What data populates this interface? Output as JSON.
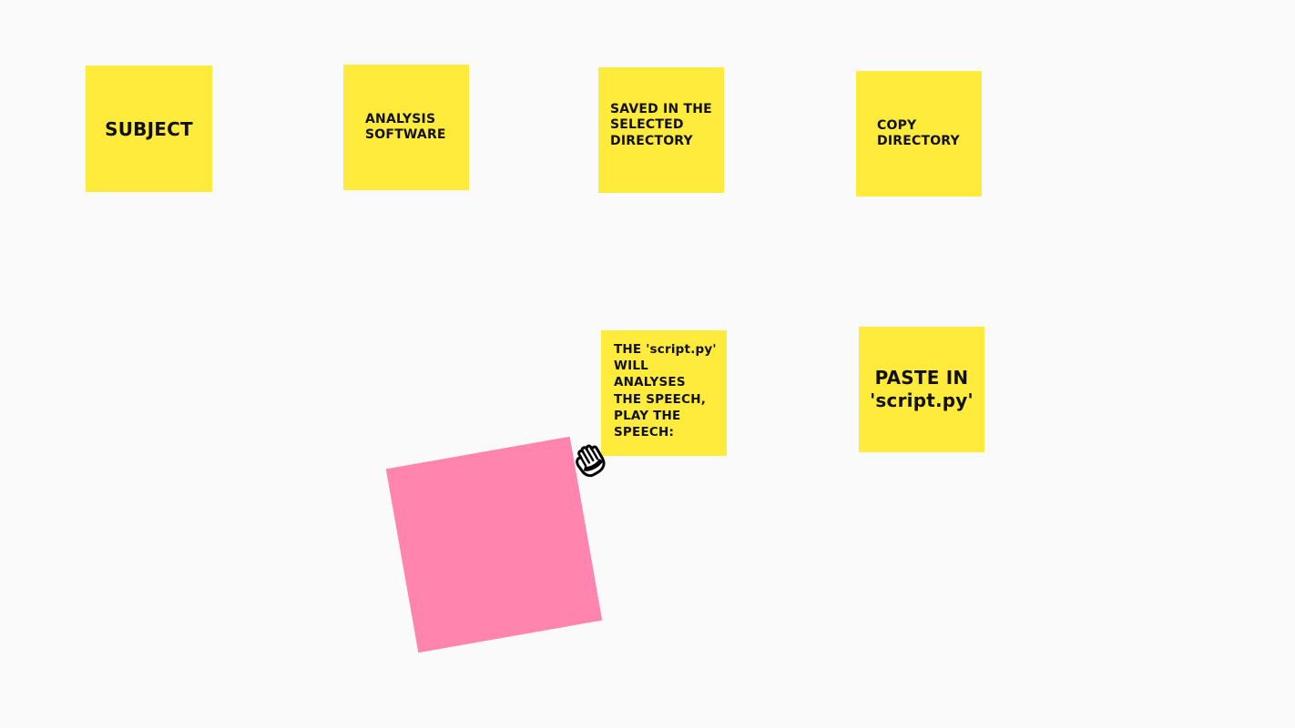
{
  "board": {
    "notes": [
      {
        "text": "SUBJECT",
        "color": "#ffeb3b"
      },
      {
        "text": "ANALYSIS\nSOFTWARE",
        "color": "#ffeb3b"
      },
      {
        "text": "SAVED IN THE\nSELECTED\nDIRECTORY",
        "color": "#ffeb3b"
      },
      {
        "text": "COPY\nDIRECTORY",
        "color": "#ffeb3b"
      },
      {
        "text": "THE 'script.py'\nWILL\nANALYSES\nTHE SPEECH,\nPLAY THE\nSPEECH:",
        "color": "#ffeb3b"
      },
      {
        "text": "PASTE IN\n'script.py'",
        "color": "#ffeb3b"
      }
    ],
    "blank_note": {
      "color": "#ff85ae"
    },
    "cursor_icon": "grab-hand-icon"
  }
}
